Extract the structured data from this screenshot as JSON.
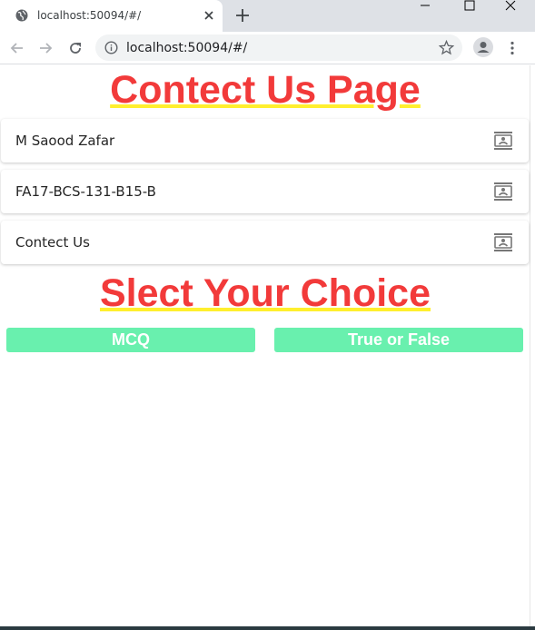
{
  "browser": {
    "tab_title": "localhost:50094/#/",
    "url": "localhost:50094/#/"
  },
  "page": {
    "title": "Contect Us Page",
    "cards": [
      {
        "label": "M Saood Zafar",
        "icon": "contact-icon"
      },
      {
        "label": "FA17-BCS-131-B15-B",
        "icon": "contact-icon"
      },
      {
        "label": "Contect Us",
        "icon": "contact-icon"
      }
    ],
    "choice_heading": "Slect Your Choice",
    "choices": [
      "MCQ",
      "True or False"
    ]
  },
  "colors": {
    "heading": "#f23a3a",
    "underline": "#ffef2e",
    "button": "#69f0ae"
  }
}
